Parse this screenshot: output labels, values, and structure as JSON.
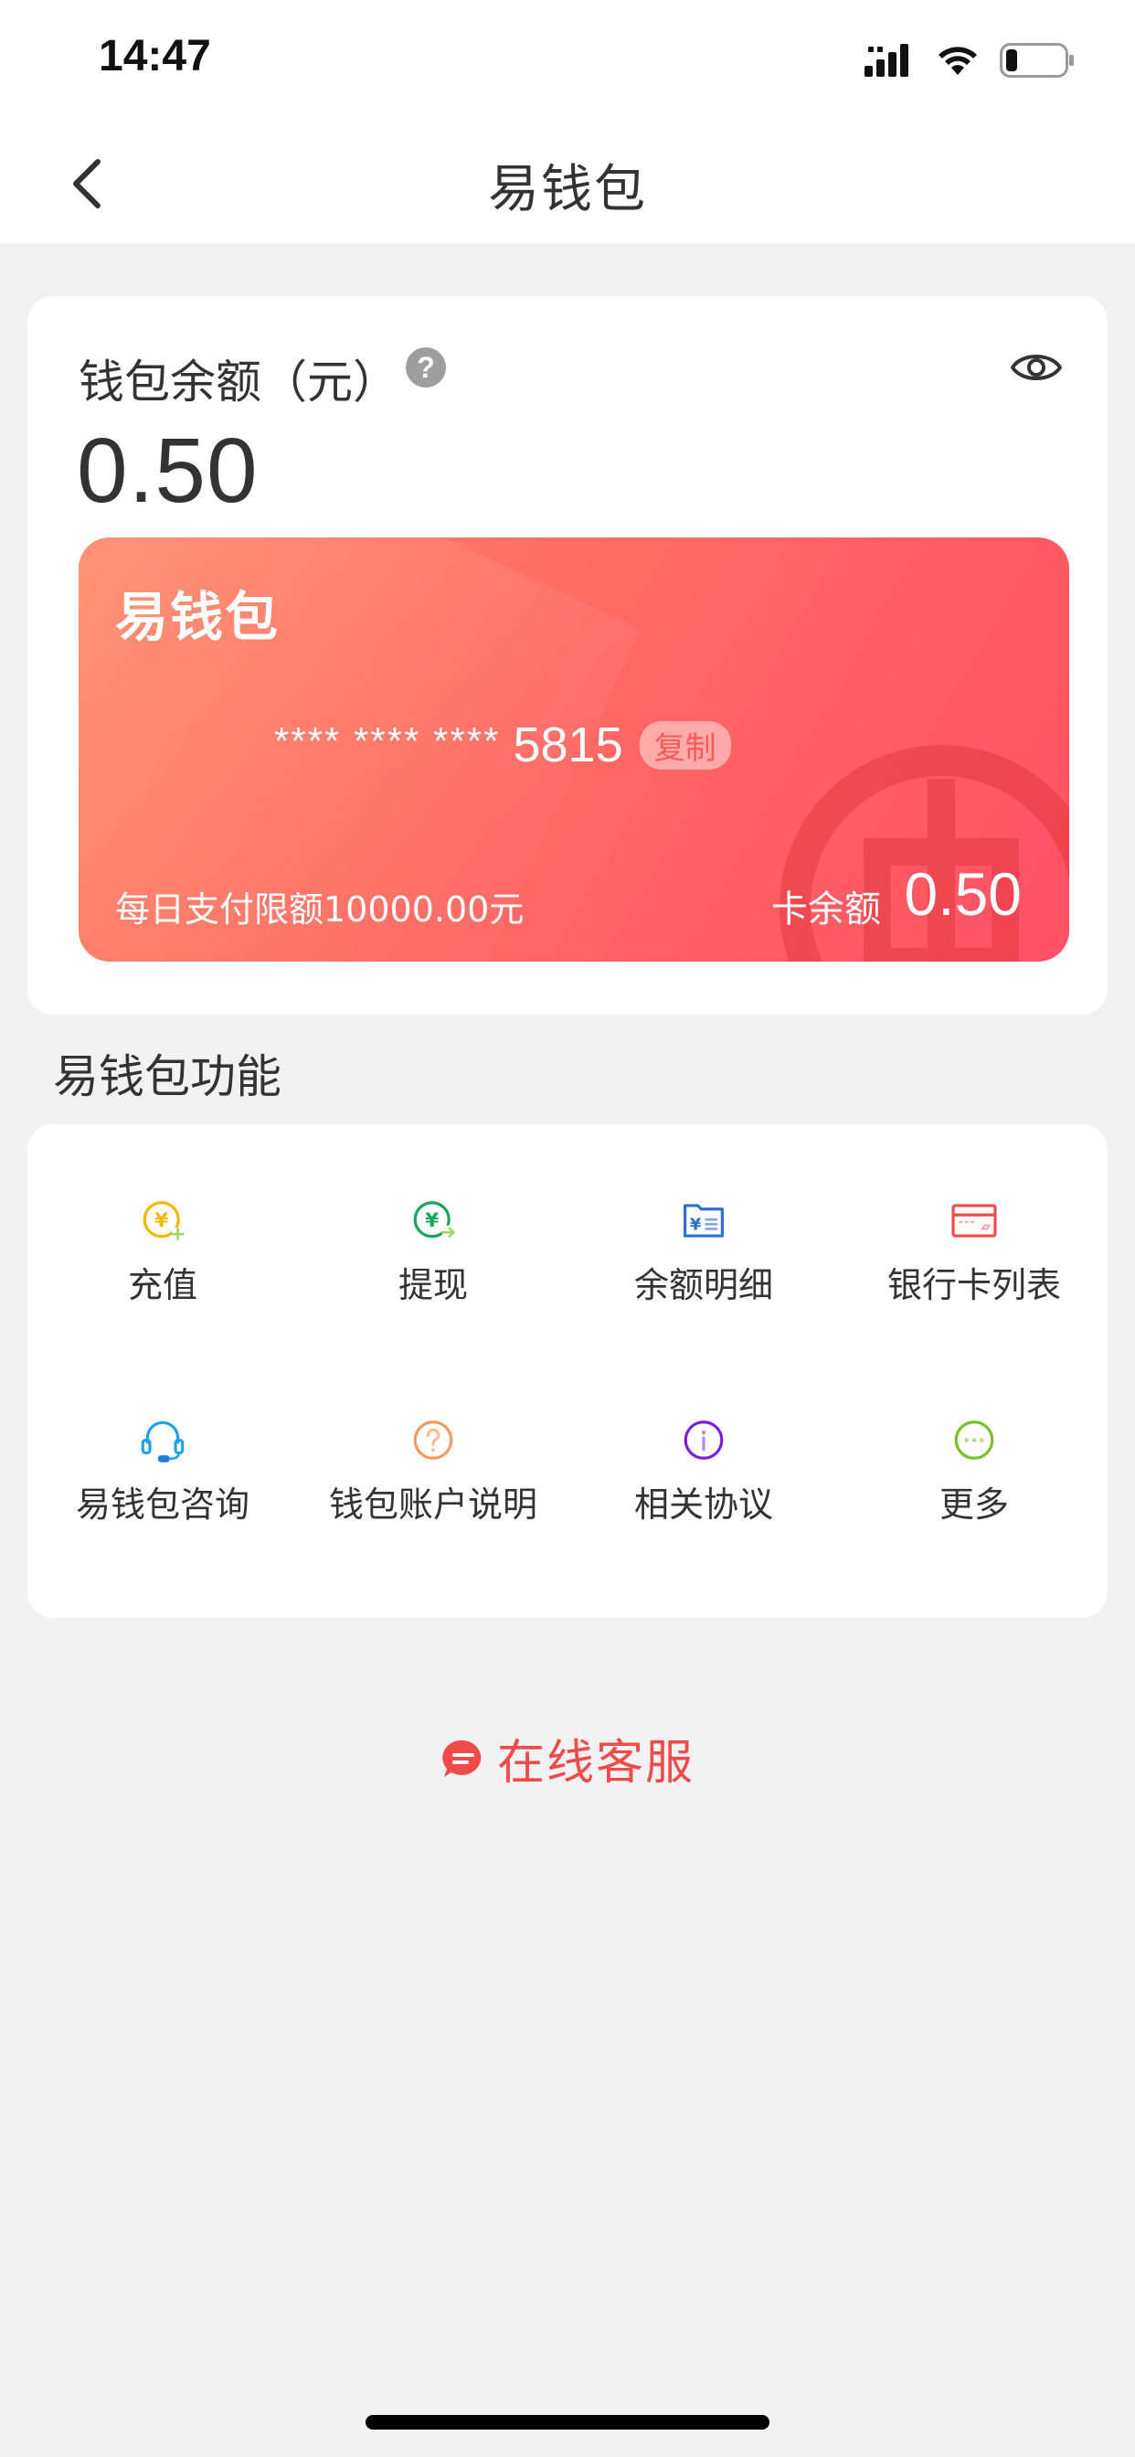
{
  "status_bar": {
    "time": "14:47"
  },
  "nav": {
    "title": "易钱包"
  },
  "balance": {
    "label": "钱包余额（元）",
    "help": "?",
    "amount": "0.50"
  },
  "wallet_card": {
    "title": "易钱包",
    "card_number_masked": "**** **** ****",
    "card_number_tail": "5815",
    "copy_label": "复制",
    "daily_limit": "每日支付限额10000.00元",
    "card_balance_label": "卡余额",
    "card_balance_value": "0.50"
  },
  "features": {
    "title": "易钱包功能",
    "items": [
      {
        "label": "充值",
        "icon": "recharge-icon"
      },
      {
        "label": "提现",
        "icon": "withdraw-icon"
      },
      {
        "label": "余额明细",
        "icon": "balance-detail-icon"
      },
      {
        "label": "银行卡列表",
        "icon": "bank-card-icon"
      },
      {
        "label": "易钱包咨询",
        "icon": "headset-icon"
      },
      {
        "label": "钱包账户说明",
        "icon": "question-icon"
      },
      {
        "label": "相关协议",
        "icon": "info-icon"
      },
      {
        "label": "更多",
        "icon": "more-icon"
      }
    ]
  },
  "online_service": {
    "label": "在线客服"
  },
  "colors": {
    "accent_red": "#f04b4b",
    "card_gradient_start": "#ff8a6a",
    "card_gradient_end": "#ff5065"
  }
}
